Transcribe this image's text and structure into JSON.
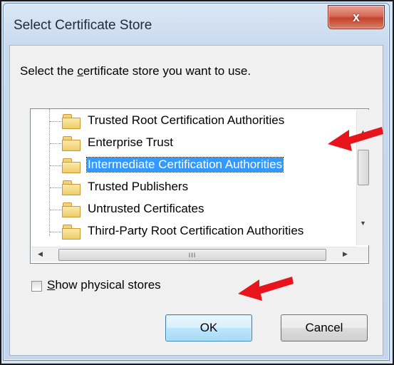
{
  "window": {
    "title": "Select Certificate Store",
    "close_label": "x"
  },
  "dialog": {
    "instruction_pre": "Select the ",
    "instruction_mnemonic": "c",
    "instruction_post": "ertificate store you want to use.",
    "stores": [
      {
        "label": "Trusted Root Certification Authorities",
        "selected": false
      },
      {
        "label": "Enterprise Trust",
        "selected": false
      },
      {
        "label": "Intermediate Certification Authorities",
        "selected": true
      },
      {
        "label": "Trusted Publishers",
        "selected": false
      },
      {
        "label": "Untrusted Certificates",
        "selected": false
      },
      {
        "label": "Third-Party Root Certification Authorities",
        "selected": false
      }
    ],
    "show_physical_mnemonic": "S",
    "show_physical_rest": "how physical stores",
    "show_physical_checked": false,
    "ok_label": "OK",
    "cancel_label": "Cancel"
  },
  "icons": {
    "folder": "folder-icon",
    "annotation_arrow": "red-arrow-icon"
  },
  "colors": {
    "selection": "#3399ff",
    "annotation": "#e8141b",
    "close_button": "#c4412b"
  }
}
